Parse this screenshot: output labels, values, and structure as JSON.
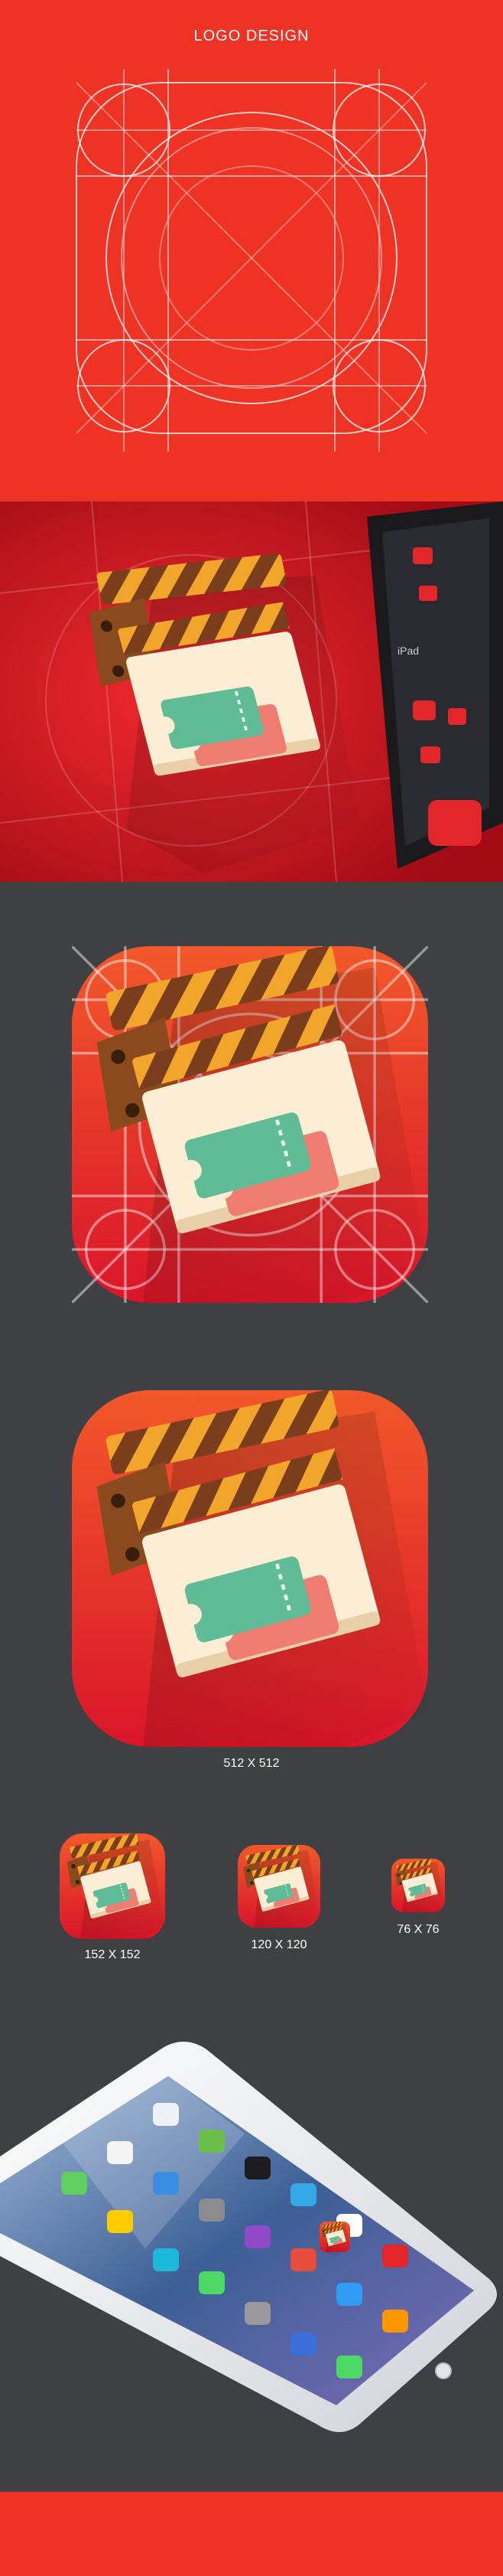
{
  "section_logo": {
    "title": "LOGO DESIGN"
  },
  "sizes": {
    "large": "512 X 512",
    "medium": "152 X 152",
    "small": "120 X 120",
    "tiny": "76 X 76"
  },
  "mockup": {
    "tablet_label": "iPad"
  },
  "colors": {
    "brand_red": "#ee3223",
    "dark_bg": "#3f4044",
    "ticket_green": "#5fbc96",
    "ticket_pink": "#ef7d71",
    "stripe_orange": "#f2a52b",
    "board_cream": "#fbeed5"
  }
}
